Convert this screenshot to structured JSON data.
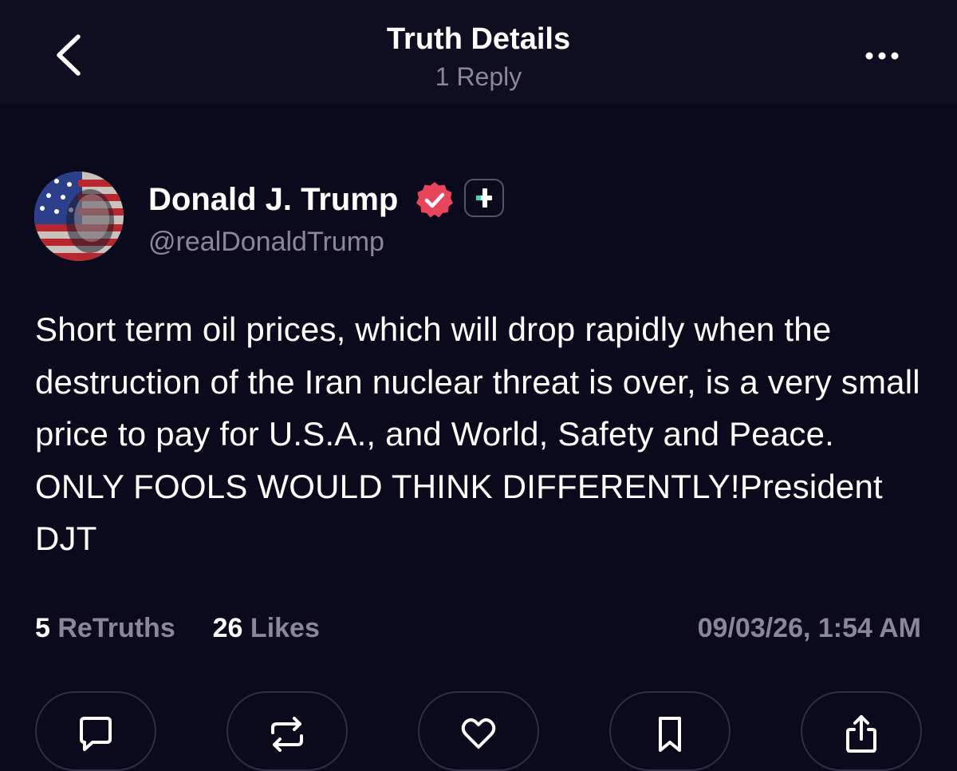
{
  "header": {
    "title": "Truth Details",
    "subtitle": "1 Reply",
    "back_icon": "chevron-left-icon",
    "more_icon": "more-horizontal-icon"
  },
  "post": {
    "author_name": "Donald J. Trump",
    "author_handle": "@realDonaldTrump",
    "verified_icon": "verified-check-icon",
    "verified_color": "#e8455c",
    "plus_icon": "truth-plus-icon",
    "plus_color": "#2de0b0",
    "text": "Short term oil prices, which will drop rapidly when the destruction of the Iran nuclear threat is over, is a very small price to pay for U.S.A., and World, Safety and Peace. ONLY FOOLS WOULD THINK DIFFERENTLY!President DJT",
    "stats": {
      "retruths_count": "5",
      "retruths_label": "ReTruths",
      "likes_count": "26",
      "likes_label": "Likes"
    },
    "timestamp": "09/03/26, 1:54 AM"
  },
  "actions": [
    {
      "name": "reply",
      "icon": "comment-icon"
    },
    {
      "name": "retruth",
      "icon": "repost-icon"
    },
    {
      "name": "like",
      "icon": "heart-icon"
    },
    {
      "name": "bookmark",
      "icon": "bookmark-icon"
    },
    {
      "name": "share",
      "icon": "share-icon"
    }
  ],
  "colors": {
    "background": "#0b0a1c",
    "header_background": "#0e0e20",
    "muted_text": "#8a8898"
  }
}
